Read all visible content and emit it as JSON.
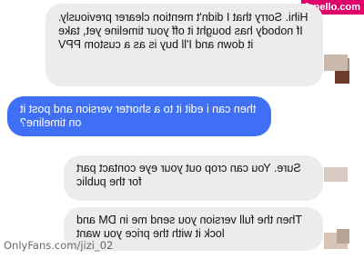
{
  "site_watermark": "fapello.com",
  "source_watermark": "OnlyFans.com/jizi_02",
  "colors": {
    "sent_bubble": "#3f6ff5",
    "received_bubble": "#ececec",
    "watermark_bg": "#e0006a"
  },
  "messages": [
    {
      "direction": "received",
      "text": "Hihi. Sorry that I didn't mention clearer previously. If nobody has bought it off your timeline yet, take it down and I'll buy is as a custom PPV"
    },
    {
      "direction": "sent",
      "text": "then can i edit it to a shorter version and post it on timeline?"
    },
    {
      "direction": "received",
      "text": "Sure. You can crop out your eye contact part for the public"
    },
    {
      "direction": "received",
      "text": "Then the full version you send me in DM and lock it with the price you want"
    }
  ]
}
